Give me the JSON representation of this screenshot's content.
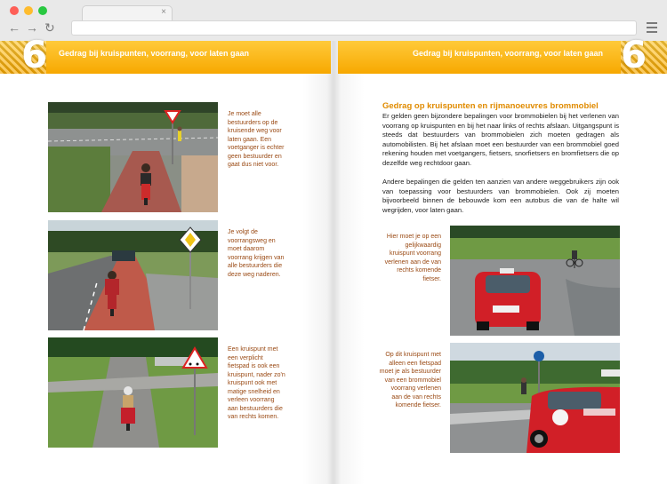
{
  "browser": {
    "address": "",
    "tab_close": "×",
    "back_glyph": "←",
    "forward_glyph": "→",
    "reload_glyph": "↻",
    "dots": [
      "#fe5f57",
      "#febc2e",
      "#29c840"
    ]
  },
  "header": {
    "chapter": "6",
    "left_title": "Gedrag bij kruispunten, voorrang, voor laten gaan",
    "right_title": "Gedrag bij kruispunten, voorrang, voor laten gaan",
    "accent": "#f7a800"
  },
  "left_page": {
    "captions": [
      "Je moet alle bestuurders op de kruisende weg voor laten gaan. Een voetganger is echter geen bestuurder en gaat dus niet voor.",
      "Je volgt de voorrangsweg en moet daarom voorrang krijgen van alle bestuurders die deze weg naderen.",
      "Een kruispunt met een verplicht fietspad is ook een kruispunt, nader zo'n kruispunt ook met matige snelheid en verleen voorrang aan bestuurders die van rechts komen."
    ]
  },
  "right_page": {
    "section_title": "Gedrag op kruispunten en rijmanoeuvres brommobiel",
    "paragraph1": "Er gelden geen bijzondere bepalingen voor brommobielen bij het verlenen van voorrang op kruispunten en bij het naar links of rechts afslaan. Uitgangspunt is steeds dat bestuurders van brommobielen zich moeten gedragen als automobilisten. Bij het afslaan moet een bestuurder van een brommobiel goed rekening houden met voetgangers, fietsers, snorfietsers en bromfietsers die op dezelfde weg rechtdoor gaan.",
    "paragraph2": "Andere bepalingen die gelden ten aanzien van andere weggebruikers zijn ook van toepassing voor bestuurders van brommobielen. Ook zij moeten bijvoorbeeld binnen de bebouwde kom een autobus die van de halte wil wegrijden, voor laten gaan.",
    "captions": [
      "Hier moet je op een gelijkwaardig kruispunt voorrang verlenen aan de van rechts komende fietser.",
      "Op dit kruispunt met alleen een fietspad moet je als bestuurder van een brommobiel voorrang verlenen aan de van rechts komende fietser."
    ]
  }
}
